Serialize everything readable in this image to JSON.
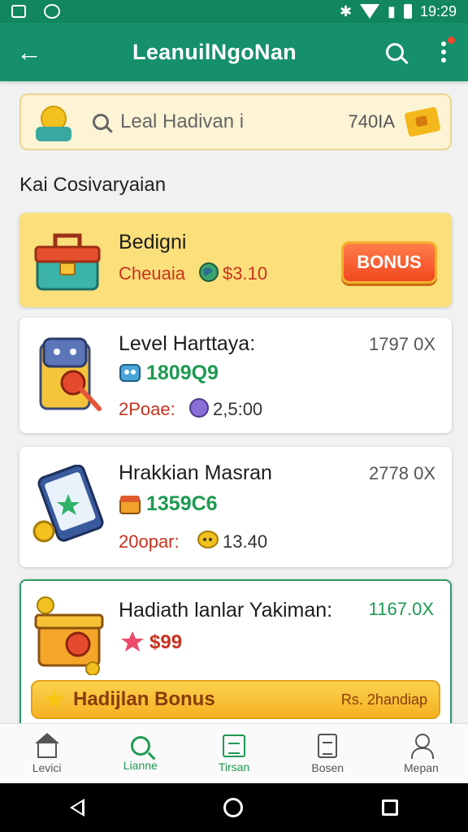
{
  "status_bar": {
    "time": "19:29"
  },
  "app_bar": {
    "title": "LeanuilNgoNan",
    "back_icon": "arrow-back-icon",
    "search_icon": "search-icon",
    "more_icon": "more-vert-icon"
  },
  "search_card": {
    "placeholder": "Leal Hadivan i",
    "value": "740IA"
  },
  "section": {
    "title": "Kai Cosivaryaian"
  },
  "bonus_card": {
    "title": "Bedigni",
    "subtitle": "Cheuaia",
    "amount": "$3.10",
    "button": "BONUS"
  },
  "items": [
    {
      "title": "Level Harttaya:",
      "right": "1797 0X",
      "green": "1809Q9",
      "red": "2Poae:",
      "value": "2,5:00"
    },
    {
      "title": "Hrakkian Masran",
      "right": "2778 0X",
      "green": "1359C6",
      "red": "20opar:",
      "value": "13.40"
    },
    {
      "title": "Hadiath lanlar Yakiman:",
      "right": "1167.0X",
      "price": "$99",
      "bar_label": "Hadijlan Bonus",
      "bar_sub": "Rs. 2handiap"
    }
  ],
  "bottom_nav": [
    {
      "label": "Levici",
      "icon": "home-icon"
    },
    {
      "label": "Lianne",
      "icon": "search-icon"
    },
    {
      "label": "Tirsan",
      "icon": "calendar-icon"
    },
    {
      "label": "Bosen",
      "icon": "document-icon"
    },
    {
      "label": "Mepan",
      "icon": "user-icon"
    }
  ],
  "colors": {
    "primary": "#15906a",
    "accent": "#f2471f",
    "green_text": "#1e9a52",
    "red_text": "#c8321f"
  }
}
